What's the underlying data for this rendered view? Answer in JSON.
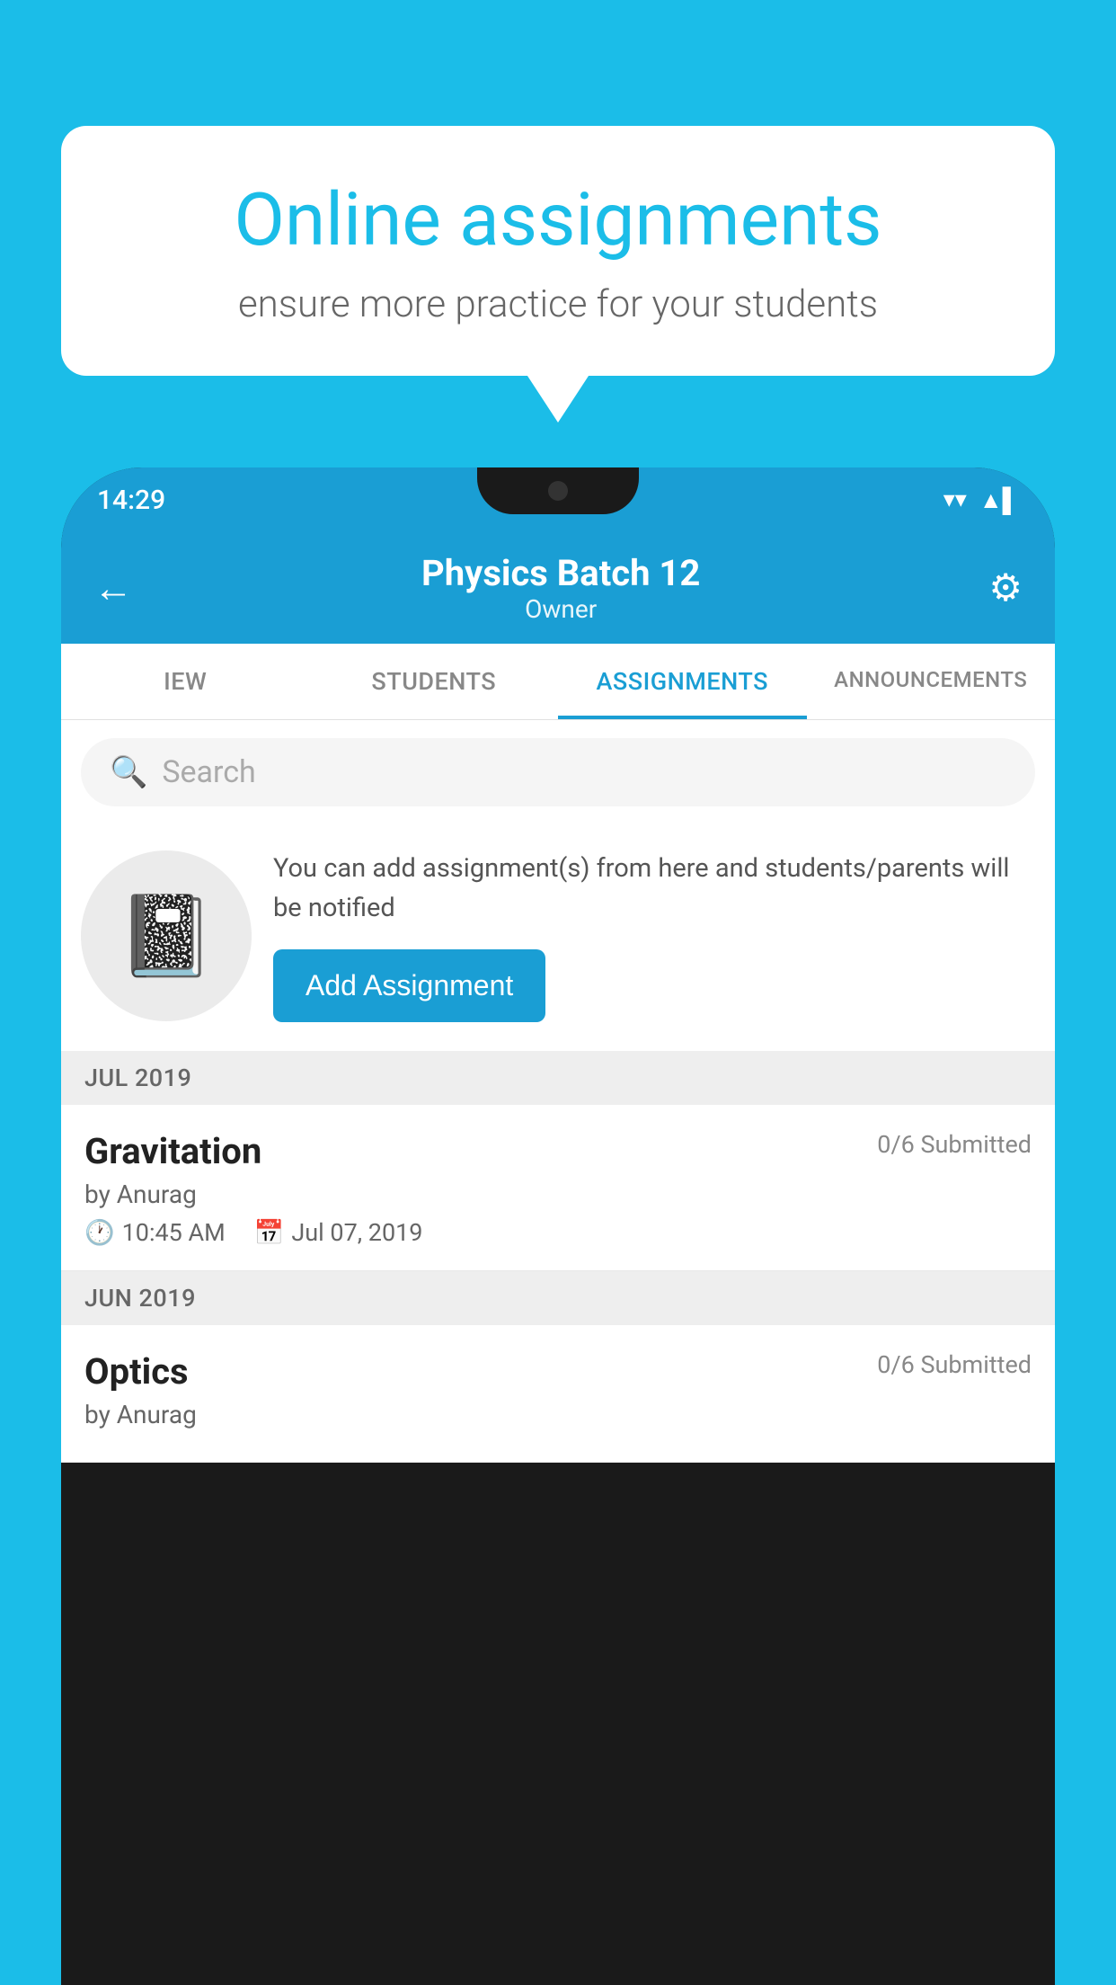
{
  "background_color": "#1BBDE8",
  "speech_bubble": {
    "title": "Online assignments",
    "subtitle": "ensure more practice for your students"
  },
  "status_bar": {
    "time": "14:29",
    "wifi_icon": "▼",
    "signal_icon": "◀",
    "battery_icon": "▌"
  },
  "header": {
    "title": "Physics Batch 12",
    "subtitle": "Owner",
    "back_label": "←",
    "gear_label": "⚙"
  },
  "tabs": [
    {
      "label": "IEW",
      "active": false
    },
    {
      "label": "STUDENTS",
      "active": false
    },
    {
      "label": "ASSIGNMENTS",
      "active": true
    },
    {
      "label": "ANNOUNCEMENTS",
      "active": false
    }
  ],
  "search": {
    "placeholder": "Search",
    "icon": "🔍"
  },
  "promo": {
    "description": "You can add assignment(s) from here and students/parents will be notified",
    "button_label": "Add Assignment",
    "icon": "📓"
  },
  "month_sections": [
    {
      "month_label": "JUL 2019",
      "assignments": [
        {
          "title": "Gravitation",
          "submitted": "0/6 Submitted",
          "author": "by Anurag",
          "time": "10:45 AM",
          "date": "Jul 07, 2019"
        }
      ]
    },
    {
      "month_label": "JUN 2019",
      "assignments": [
        {
          "title": "Optics",
          "submitted": "0/6 Submitted",
          "author": "by Anurag",
          "time": "",
          "date": ""
        }
      ]
    }
  ]
}
